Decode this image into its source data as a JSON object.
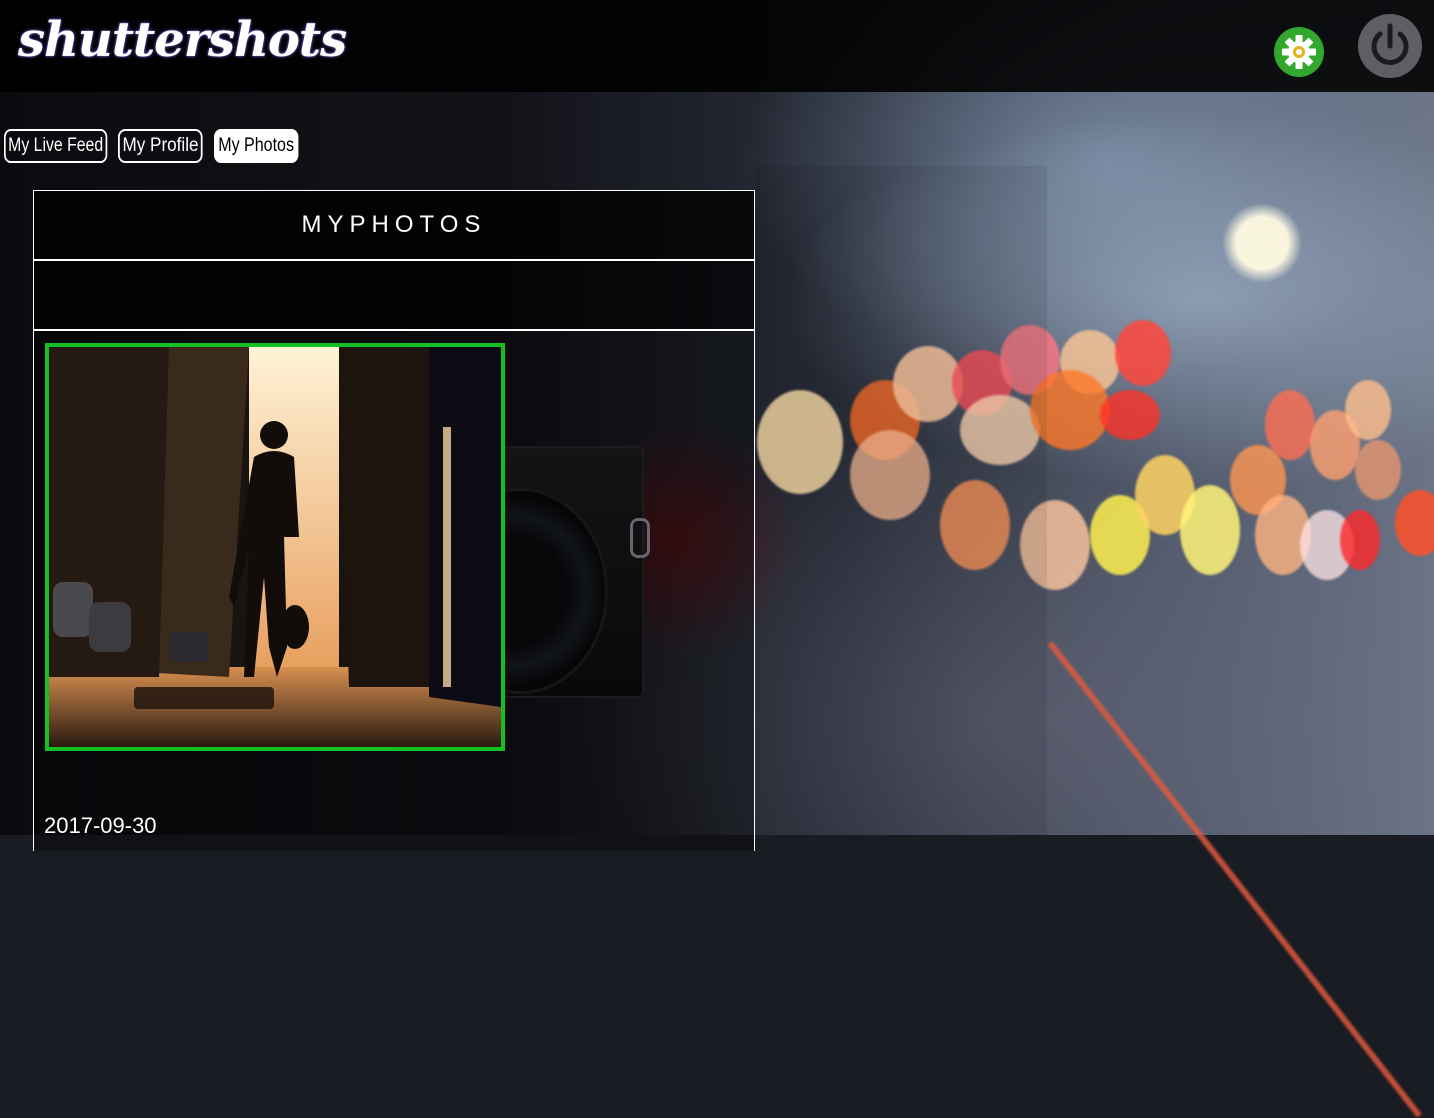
{
  "app": {
    "logo_text": "shuttershots"
  },
  "header": {
    "settings_icon": "gear-icon",
    "logout_icon": "power-icon",
    "settings_color": "#31a82d"
  },
  "tabs": [
    {
      "label": "My Live Feed",
      "active": false
    },
    {
      "label": "My Profile",
      "active": false
    },
    {
      "label": "My Photos",
      "active": true
    }
  ],
  "photos_panel": {
    "title": "MYPHOTOS",
    "photos": [
      {
        "date": "2017-09-30",
        "border_color": "#12c020"
      }
    ]
  }
}
